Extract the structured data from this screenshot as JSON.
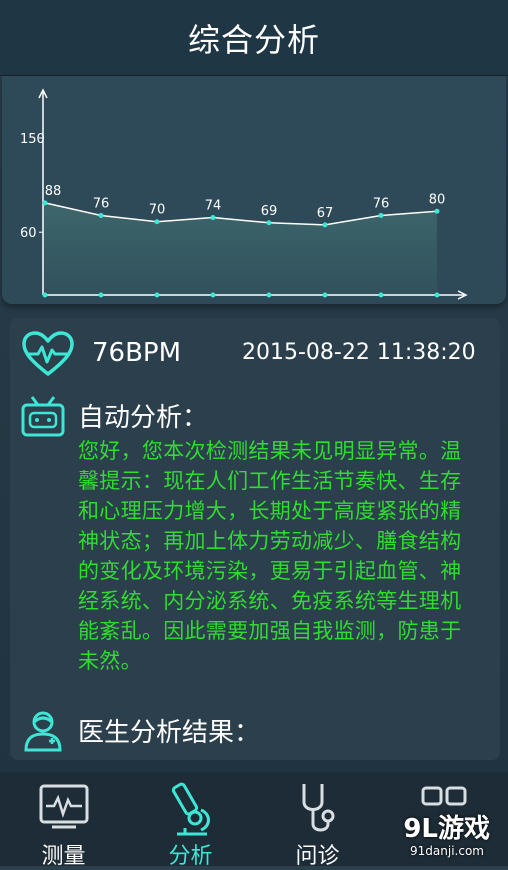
{
  "header": {
    "title": "综合分析"
  },
  "chart_data": {
    "type": "line",
    "y_ticks": [
      "150",
      "60"
    ],
    "x": [
      1,
      2,
      3,
      4,
      5,
      6,
      7,
      8
    ],
    "values": [
      88,
      76,
      70,
      74,
      69,
      67,
      76,
      80
    ],
    "point_labels": [
      "88",
      "76",
      "70",
      "74",
      "69",
      "67",
      "76",
      "80"
    ],
    "ylim": [
      0,
      150
    ]
  },
  "reading": {
    "bpm": "76BPM",
    "timestamp": "2015-08-22 11:38:20"
  },
  "auto_analysis": {
    "title": "自动分析：",
    "text": "您好，您本次检测结果未见明显异常。温馨提示：现在人们工作生活节奏快、生存和心理压力增大，长期处于高度紧张的精神状态；再加上体力劳动减少、膳食结构的变化及环境污染，更易于引起血管、神经系统、内分泌系统、免疫系统等生理机能紊乱。因此需要加强自我监测，防患于未然。"
  },
  "doctor_analysis": {
    "title": "医生分析结果："
  },
  "tabs": [
    {
      "label": "测量",
      "icon": "ecg-monitor-icon",
      "active": false
    },
    {
      "label": "分析",
      "icon": "microscope-icon",
      "active": true
    },
    {
      "label": "问诊",
      "icon": "stethoscope-icon",
      "active": false
    },
    {
      "label": "",
      "icon": "more-icon",
      "active": false
    }
  ],
  "watermark": {
    "brand": "9L游戏",
    "url": "91danji.com"
  },
  "colors": {
    "accent": "#3ee6d6",
    "analysis_text": "#2fdc2f",
    "chart_line": "#ffffff"
  }
}
